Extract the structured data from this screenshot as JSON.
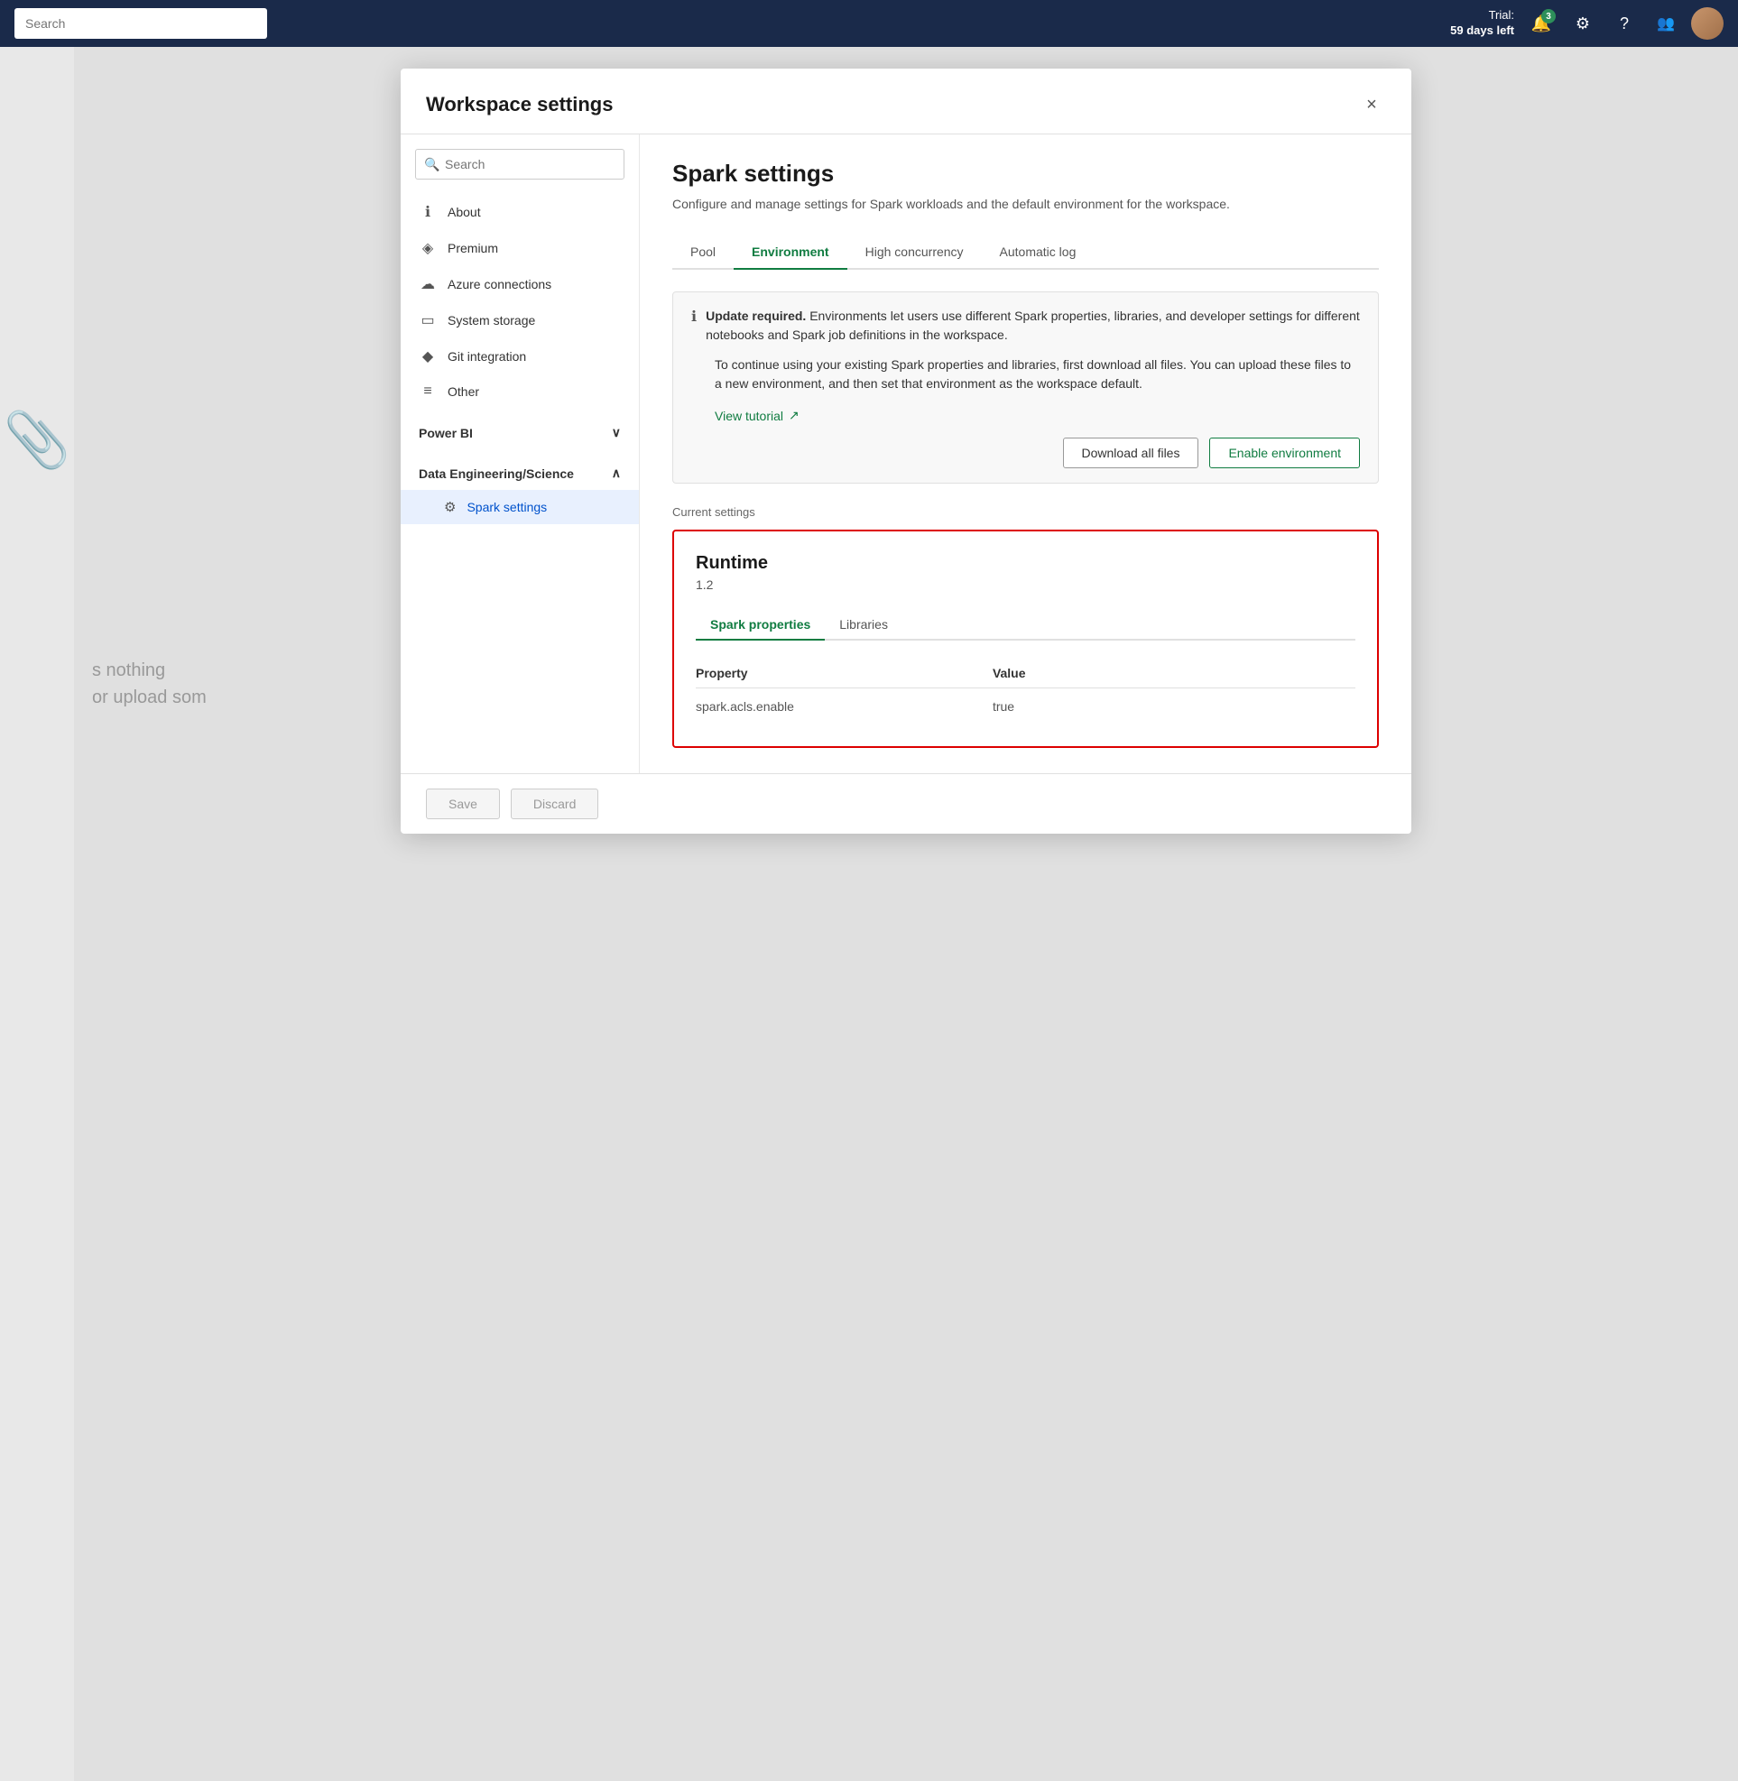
{
  "topbar": {
    "search_placeholder": "Search",
    "trial_label": "Trial:",
    "days_left": "59 days left",
    "notification_badge": "3",
    "icons": {
      "bell": "🔔",
      "settings": "⚙",
      "question": "?",
      "people": "👥"
    }
  },
  "modal": {
    "title": "Workspace settings",
    "close_label": "×"
  },
  "search": {
    "placeholder": "Search"
  },
  "nav": {
    "items": [
      {
        "id": "about",
        "label": "About",
        "icon": "ℹ"
      },
      {
        "id": "premium",
        "label": "Premium",
        "icon": "◈"
      },
      {
        "id": "azure-connections",
        "label": "Azure connections",
        "icon": "☁"
      },
      {
        "id": "system-storage",
        "label": "System storage",
        "icon": "▭"
      },
      {
        "id": "git-integration",
        "label": "Git integration",
        "icon": "◆"
      },
      {
        "id": "other",
        "label": "Other",
        "icon": "≡"
      }
    ],
    "sections": [
      {
        "id": "power-bi",
        "label": "Power BI",
        "expanded": false,
        "children": []
      },
      {
        "id": "data-engineering",
        "label": "Data Engineering/Science",
        "expanded": true,
        "children": [
          {
            "id": "spark-settings",
            "label": "Spark settings",
            "icon": "⚙",
            "active": true
          }
        ]
      }
    ]
  },
  "content": {
    "title": "Spark settings",
    "description": "Configure and manage settings for Spark workloads and the default environment for the workspace.",
    "tabs": [
      {
        "id": "pool",
        "label": "Pool",
        "active": false
      },
      {
        "id": "environment",
        "label": "Environment",
        "active": true
      },
      {
        "id": "high-concurrency",
        "label": "High concurrency",
        "active": false
      },
      {
        "id": "automatic-log",
        "label": "Automatic log",
        "active": false
      }
    ],
    "alert": {
      "icon": "ℹ",
      "title_bold": "Update required.",
      "title_text": " Environments let users use different Spark properties, libraries, and developer settings for different notebooks and Spark job definitions in the workspace.",
      "body": "To continue using your existing Spark properties and libraries, first download all files. You can upload these files to a new environment, and then set that environment as the workspace default.",
      "link": "View tutorial",
      "link_icon": "↗",
      "actions": {
        "download": "Download all files",
        "enable": "Enable environment"
      }
    },
    "current_settings_label": "Current settings",
    "runtime": {
      "label": "Runtime",
      "version": "1.2",
      "sub_tabs": [
        {
          "id": "spark-properties",
          "label": "Spark properties",
          "active": true
        },
        {
          "id": "libraries",
          "label": "Libraries",
          "active": false
        }
      ],
      "table": {
        "col_property": "Property",
        "col_value": "Value",
        "rows": [
          {
            "property": "spark.acls.enable",
            "value": "true"
          }
        ]
      }
    }
  },
  "footer": {
    "save_label": "Save",
    "discard_label": "Discard"
  },
  "background": {
    "nothing_text": "s nothing",
    "upload_text": "or upload som"
  }
}
